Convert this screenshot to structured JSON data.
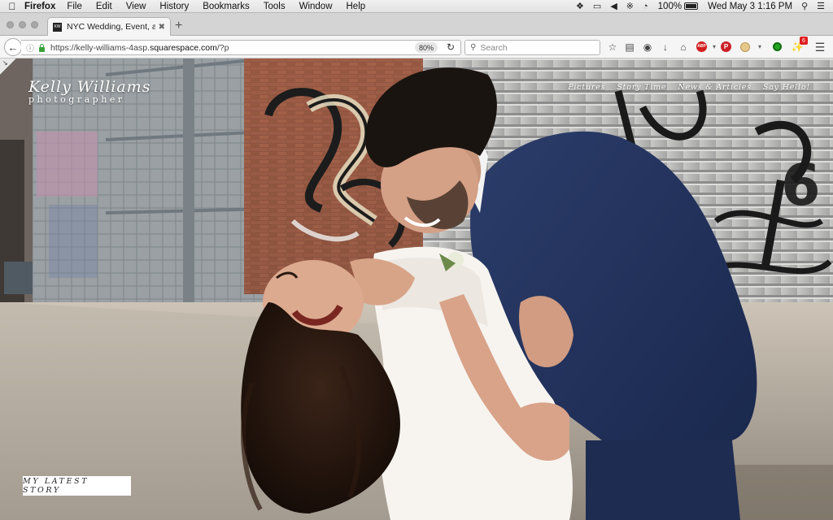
{
  "menubar": {
    "apple_icon": "apple-icon",
    "app_name": "Firefox",
    "menus": [
      "File",
      "Edit",
      "View",
      "History",
      "Bookmarks",
      "Tools",
      "Window",
      "Help"
    ],
    "status_icons": [
      "dropbox-icon",
      "airplay-icon",
      "volume-icon",
      "bluetooth-icon",
      "wifi-icon"
    ],
    "battery_text": "100%",
    "battery_level": 1.0,
    "clock": "Wed May 3  1:16 PM",
    "search_icon": "spotlight-icon",
    "list_icon": "notification-center-icon"
  },
  "browser": {
    "tab": {
      "title": "NYC Wedding, Event, and Por",
      "favicon_text": "KW"
    },
    "url": {
      "prefix": "https://kelly-williams-4asp.",
      "host": "squarespace.com",
      "suffix": "/?p"
    },
    "zoom": "80%",
    "search_placeholder": "Search",
    "extension_badge": "6",
    "colors": {
      "abp": "#d21f1f",
      "pinterest": "#cb1f27",
      "green_ext": "#23a323"
    }
  },
  "site": {
    "logo_name": "Kelly Williams",
    "logo_tagline": "photographer",
    "nav": [
      "Pictures",
      "Story Time",
      "News & Articles",
      "Say Hello!"
    ],
    "cta": "MY LATEST STORY"
  }
}
